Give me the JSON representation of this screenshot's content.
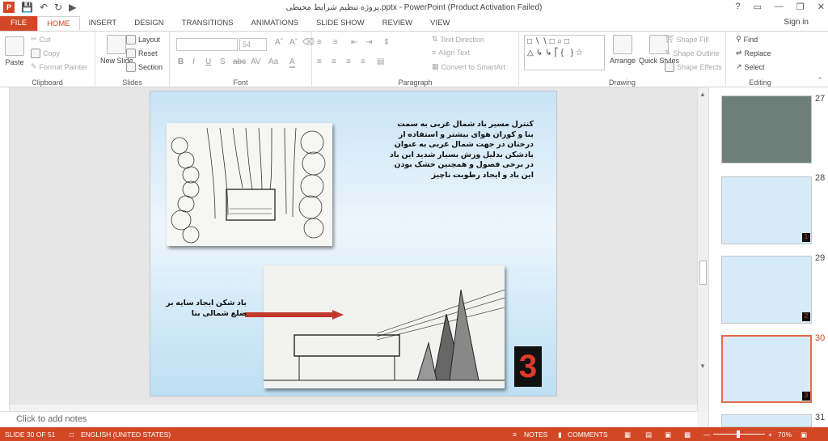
{
  "window": {
    "title": "پروژه تنظیم شرایط محیطی.pptx - PowerPoint (Product Activation Failed)",
    "controls": [
      "?",
      "▭",
      "—",
      "❐",
      "✕"
    ]
  },
  "tabs": [
    "FILE",
    "HOME",
    "INSERT",
    "DESIGN",
    "TRANSITIONS",
    "ANIMATIONS",
    "SLIDE SHOW",
    "REVIEW",
    "VIEW"
  ],
  "active_tab": "HOME",
  "sign_in": "Sign in",
  "ribbon": {
    "clipboard": {
      "label": "Clipboard",
      "paste": "Paste",
      "cut": "Cut",
      "copy": "Copy",
      "format_painter": "Format Painter"
    },
    "slides": {
      "label": "Slides",
      "new_slide": "New Slide",
      "layout": "Layout",
      "reset": "Reset",
      "section": "Section"
    },
    "font": {
      "label": "Font",
      "font_size": "54",
      "buttons": [
        "B",
        "I",
        "U",
        "S",
        "abc",
        "AV",
        "Aa",
        "A"
      ]
    },
    "paragraph": {
      "label": "Paragraph",
      "text_direction": "Text Direction",
      "align_text": "Align Text",
      "convert_smartart": "Convert to SmartArt"
    },
    "drawing": {
      "label": "Drawing",
      "arrange": "Arrange",
      "quick_styles": "Quick Styles",
      "shape_fill": "Shape Fill",
      "shape_outline": "Shape Outline",
      "shape_effects": "Shape Effects"
    },
    "editing": {
      "label": "Editing",
      "find": "Find",
      "replace": "Replace",
      "select": "Select"
    }
  },
  "slide": {
    "text_top": "کنترل مسیر باد شمال غربی به سمت بنا و کوران هوای بیشتر و استفاده از درختان در جهت شمال غربی به عنوان بادشکن بدلیل وزش بسیار شدید این باد در برخی فصول و همچنین خشک بودن این باد و ایجاد رطوبت ناچیز",
    "text_bottom": "باد شکن ایجاد سایه بر ضلع شمالی بنا",
    "number_badge": "3",
    "arrow_color": "#c0392b"
  },
  "thumbnails": [
    {
      "num": "27",
      "badge": ""
    },
    {
      "num": "28",
      "badge": "1"
    },
    {
      "num": "29",
      "badge": "2"
    },
    {
      "num": "30",
      "badge": "3"
    },
    {
      "num": "31",
      "badge": ""
    }
  ],
  "notes_placeholder": "Click to add notes",
  "status": {
    "slide_count": "SLIDE 30 OF 51",
    "language": "ENGLISH (UNITED STATES)",
    "notes": "NOTES",
    "comments": "COMMENTS",
    "zoom": "70%"
  },
  "accent_color": "#d24726"
}
